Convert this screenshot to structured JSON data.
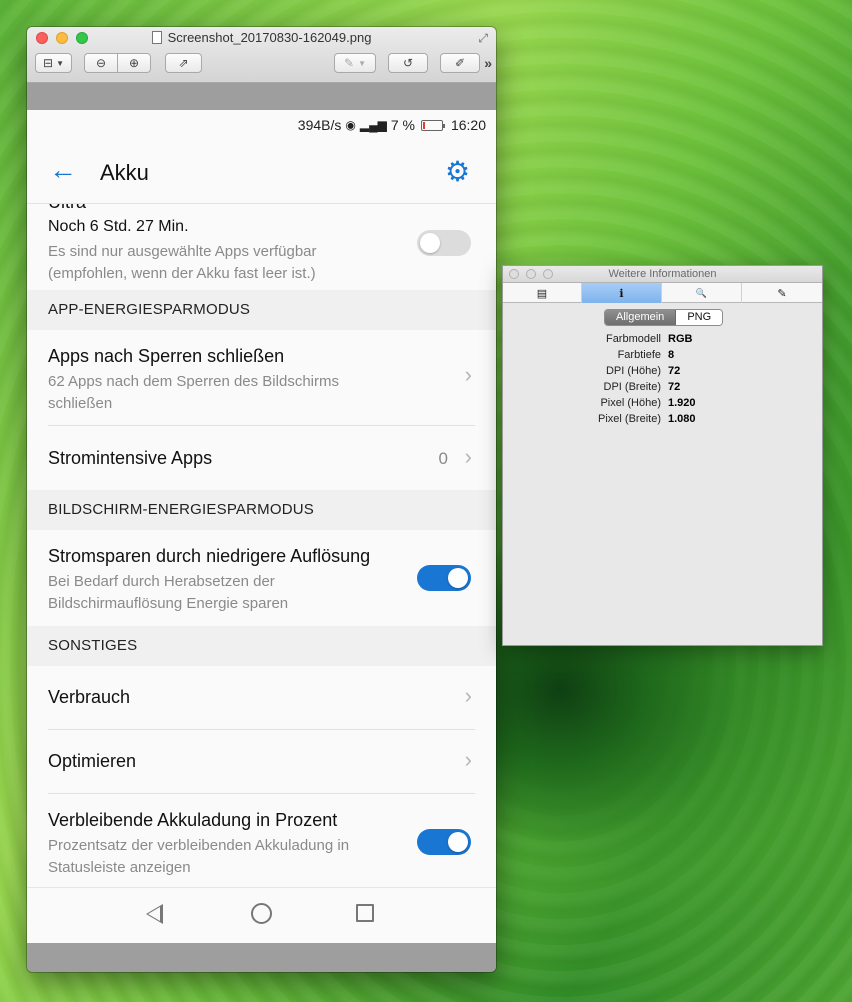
{
  "preview": {
    "title": "Screenshot_20170830-162049.png",
    "toolbar": {
      "sidebar_icon": "⊟",
      "zoom_out_icon": "⊖",
      "zoom_in_icon": "⊕",
      "share_icon": "⇗",
      "markup_icon": "✎",
      "rotate_icon": "↺",
      "annotate_icon": "✐",
      "more_icon": "»",
      "fullscreen_icon": "⤢"
    }
  },
  "statusbar": {
    "speed": "394B/s",
    "wifi_icon": "◉",
    "signal_icon": "▂▄▆",
    "battery_percent": "7 %",
    "time": "16:20"
  },
  "appbar": {
    "back_icon": "←",
    "title": "Akku",
    "gear_icon": "⚙"
  },
  "ultra": {
    "title_partial": "Ultra",
    "remaining": "Noch 6 Std. 27 Min.",
    "desc_line1": "Es sind nur ausgewählte Apps verfügbar",
    "desc_line2": "(empfohlen, wenn der Akku fast leer ist.)",
    "toggle_on": false
  },
  "sections": {
    "app": "APP-ENERGIESPARMODUS",
    "screen": "BILDSCHIRM-ENERGIESPARMODUS",
    "other": "SONSTIGES"
  },
  "items": {
    "close_apps": {
      "title": "Apps nach Sperren schließen",
      "desc_line1": "62 Apps nach dem Sperren des Bildschirms",
      "desc_line2": "schließen"
    },
    "intensive": {
      "title": "Stromintensive Apps",
      "count": "0"
    },
    "resolution": {
      "title": "Stromsparen durch niedrigere Auflösung",
      "desc_line1": "Bei Bedarf durch Herabsetzen der",
      "desc_line2": "Bildschirmauflösung Energie sparen",
      "toggle_on": true
    },
    "usage": {
      "title": "Verbrauch"
    },
    "optimize": {
      "title": "Optimieren"
    },
    "percent": {
      "title": "Verbleibende Akkuladung in Prozent",
      "desc_line1": "Prozentsatz der verbleibenden Akkuladung in",
      "desc_line2": "Statusleiste anzeigen",
      "toggle_on": true
    },
    "chevron": "›"
  },
  "info": {
    "title": "Weitere Informationen",
    "tabs": {
      "general_icon": "▤",
      "info_icon": "ℹ",
      "search_icon": "🔍",
      "pen_icon": "✎"
    },
    "segments": {
      "general": "Allgemein",
      "png": "PNG"
    },
    "rows": [
      {
        "key": "Farbmodell",
        "value": "RGB"
      },
      {
        "key": "Farbtiefe",
        "value": "8"
      },
      {
        "key": "DPI (Höhe)",
        "value": "72"
      },
      {
        "key": "DPI (Breite)",
        "value": "72"
      },
      {
        "key": "Pixel (Höhe)",
        "value": "1.920"
      },
      {
        "key": "Pixel (Breite)",
        "value": "1.080"
      }
    ]
  }
}
